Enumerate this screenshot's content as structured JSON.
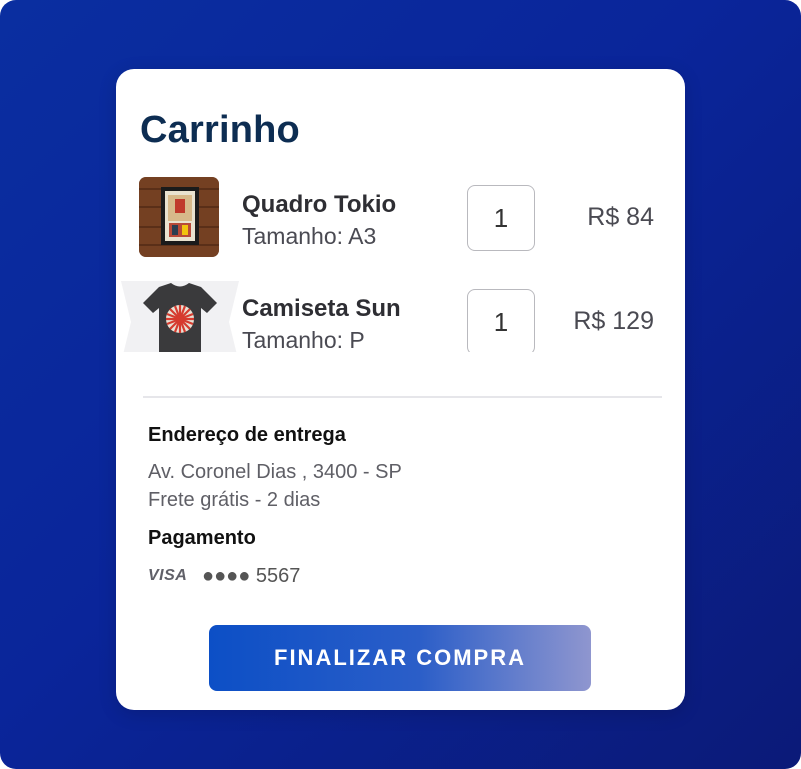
{
  "cart": {
    "title": "Carrinho",
    "items": [
      {
        "name": "Quadro Tokio",
        "size_label": "Tamanho: A3",
        "quantity": "1",
        "price": "R$ 84",
        "thumbnail_icon": "framed-poster-icon"
      },
      {
        "name": "Camiseta Sun",
        "size_label": "Tamanho: P",
        "quantity": "1",
        "price": "R$ 129",
        "thumbnail_icon": "tshirt-icon"
      }
    ]
  },
  "delivery": {
    "heading": "Endereço de entrega",
    "address": "Av. Coronel Dias , 3400 - SP",
    "shipping": "Frete grátis - 2 dias"
  },
  "payment": {
    "heading": "Pagamento",
    "brand": "VISA",
    "card_number": "●●●● 5567"
  },
  "checkout": {
    "button_label": "FINALIZAR COMPRA"
  },
  "colors": {
    "background": "#0a259a",
    "title": "#0d2d52",
    "button_start": "#0c4fc6",
    "button_end": "#8f96cf"
  }
}
